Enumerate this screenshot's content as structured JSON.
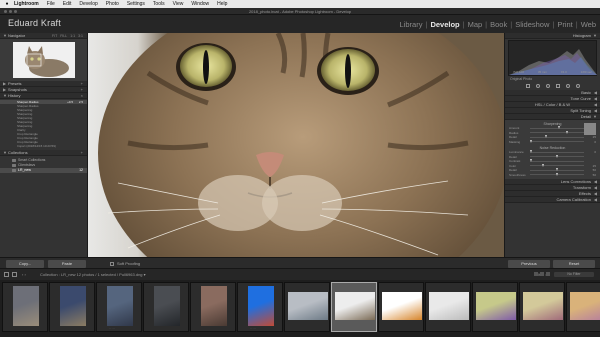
{
  "menubar": {
    "apple": "",
    "app": "Lightroom",
    "items": [
      "File",
      "Edit",
      "Develop",
      "Photo",
      "Settings",
      "Tools",
      "View",
      "Window",
      "Help"
    ]
  },
  "window": {
    "title": "2018_photo.lrcat - Adobe Photoshop Lightroom - Develop"
  },
  "identity": "Eduard Kraft",
  "modules": [
    "Library",
    "Develop",
    "Map",
    "Book",
    "Slideshow",
    "Print",
    "Web"
  ],
  "active_module": "Develop",
  "left": {
    "navigator": {
      "label": "Navigator",
      "opts": [
        "FIT",
        "FILL",
        "1:1",
        "3:1"
      ]
    },
    "presets": "Presets",
    "snapshots": "Snapshots",
    "history": {
      "label": "History",
      "items": [
        {
          "name": "Sharpen Radius",
          "v1": "+0.5",
          "v2": "2.5",
          "selected": true
        },
        {
          "name": "Sharpen Radius",
          "v1": "",
          "v2": "",
          "selected": false
        },
        {
          "name": "Sharpening",
          "v1": "",
          "v2": "",
          "selected": false
        },
        {
          "name": "Sharpening",
          "v1": "",
          "v2": "",
          "selected": false
        },
        {
          "name": "Sharpening",
          "v1": "",
          "v2": "",
          "selected": false
        },
        {
          "name": "Sharpening",
          "v1": "",
          "v2": "",
          "selected": false
        },
        {
          "name": "Sharpening",
          "v1": "",
          "v2": "",
          "selected": false
        },
        {
          "name": "Clarity",
          "v1": "",
          "v2": "",
          "selected": false
        },
        {
          "name": "Crop Rectangle",
          "v1": "",
          "v2": "",
          "selected": false
        },
        {
          "name": "Crop Rectangle",
          "v1": "",
          "v2": "",
          "selected": false
        },
        {
          "name": "Crop Rectangle",
          "v1": "",
          "v2": "",
          "selected": false
        },
        {
          "name": "Import (2018/12/15 10:23:59)",
          "v1": "",
          "v2": "",
          "selected": false
        }
      ]
    },
    "collections": {
      "label": "Collections",
      "items": [
        {
          "name": "Smart Collections",
          "count": "",
          "selected": false
        },
        {
          "name": "Clientsfavs",
          "count": "",
          "selected": false
        },
        {
          "name": "LR_new",
          "count": "12",
          "selected": true
        }
      ]
    }
  },
  "right": {
    "histogram": "Histogram",
    "histo_info": [
      "ISO 100",
      "35 mm",
      "f/4.0",
      "1/80 sec"
    ],
    "original_photo": "Original Photo",
    "panels": [
      "Basic",
      "Tone Curve",
      "Split Toning",
      "Detail",
      "Lens Corrections",
      "Transform",
      "Effects",
      "Camera Calibration"
    ],
    "hsl": "HSL / Color / B & W",
    "detail": {
      "sharpening": "Sharpening",
      "sliders": [
        {
          "label": "Amount",
          "value": "67",
          "pos": 0.55
        },
        {
          "label": "Radius",
          "value": "2.5",
          "pos": 0.7
        },
        {
          "label": "Detail",
          "value": "25",
          "pos": 0.3
        },
        {
          "label": "Masking",
          "value": "0",
          "pos": 0.02
        }
      ],
      "noise": "Noise Reduction",
      "noise_sliders": [
        {
          "label": "Luminance",
          "value": "0",
          "pos": 0.02
        },
        {
          "label": "Detail",
          "value": "",
          "pos": 0.5
        },
        {
          "label": "Contrast",
          "value": "",
          "pos": 0.02
        },
        {
          "label": "Color",
          "value": "25",
          "pos": 0.25
        },
        {
          "label": "Detail",
          "value": "50",
          "pos": 0.5
        },
        {
          "label": "Smoothness",
          "value": "50",
          "pos": 0.5
        }
      ]
    }
  },
  "toolbar": {
    "copy": "Copy...",
    "paste": "Paste",
    "soft_proofing": "Soft Proofing",
    "previous": "Previous",
    "reset": "Reset"
  },
  "filmstrip": {
    "nav": "‹ ›",
    "path": "Collection : LR_new   12 photos / 1 selected / Pull6963.dng ▾",
    "filter_label": "Filter :",
    "no_filter": "No Filter",
    "thumbs": [
      {
        "bg": "#6d6f78",
        "fg": "#9a8d7a",
        "sel": false,
        "dots": ""
      },
      {
        "bg": "#3b4a6d",
        "fg": "#8b7c63",
        "sel": false,
        "dots": ""
      },
      {
        "bg": "#55657e",
        "fg": "#30384a",
        "sel": false,
        "dots": "....."
      },
      {
        "bg": "#4a4d52",
        "fg": "#23262a",
        "sel": false,
        "dots": ""
      },
      {
        "bg": "#8a6b5f",
        "fg": "#4a3a33",
        "sel": false,
        "dots": ""
      },
      {
        "bg": "#1f6fe0",
        "fg": "#c04b37",
        "sel": false,
        "dots": "....."
      },
      {
        "bg": "#b8bdc4",
        "fg": "#6d7a86",
        "sel": false,
        "dots": ""
      },
      {
        "bg": "#ededed",
        "fg": "#7a6a55",
        "sel": true,
        "dots": ""
      },
      {
        "bg": "#ffffff",
        "fg": "#d6842a",
        "sel": false,
        "dots": ""
      },
      {
        "bg": "#e9e9e9",
        "fg": "#bbbbbb",
        "sel": false,
        "dots": ""
      },
      {
        "bg": "#c6c98a",
        "fg": "#7f5aa8",
        "sel": false,
        "dots": ""
      },
      {
        "bg": "#d3c99a",
        "fg": "#a06a7a",
        "sel": false,
        "dots": ""
      },
      {
        "bg": "#d9b27a",
        "fg": "#b37aa0",
        "sel": false,
        "dots": ""
      }
    ]
  },
  "colors": {
    "accent": "#e6e6e6",
    "panel": "#333333",
    "background": "#1f1f1f"
  }
}
